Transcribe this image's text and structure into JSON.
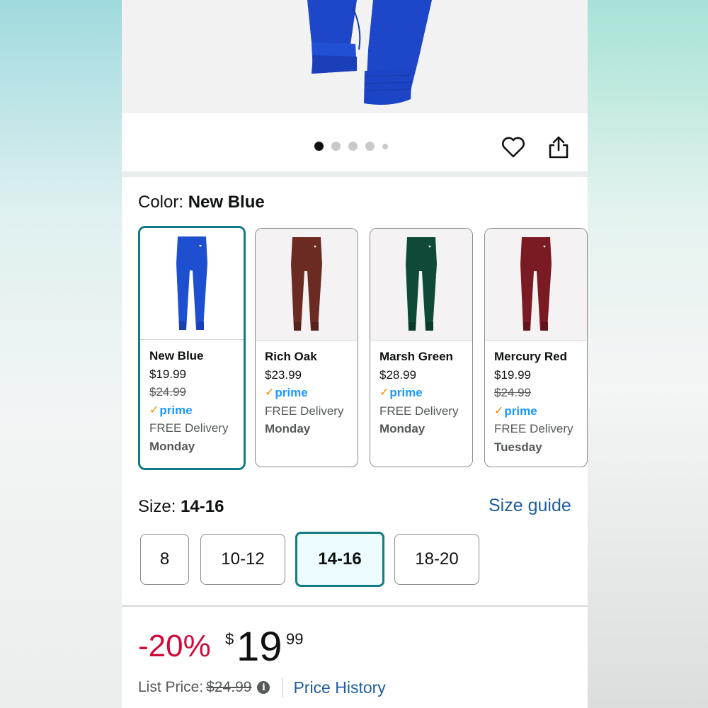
{
  "gallery": {
    "dots": 5,
    "active_dot": 1,
    "icons": [
      "heart-icon",
      "share-icon"
    ]
  },
  "color": {
    "label": "Color:",
    "selected": "New Blue",
    "options": [
      {
        "name": "New Blue",
        "price": "$19.99",
        "was": "$24.99",
        "prime": "prime",
        "delivery": "FREE Delivery",
        "day": "Monday",
        "hex": "#1e4fd1"
      },
      {
        "name": "Rich Oak",
        "price": "$23.99",
        "prime": "prime",
        "delivery": "FREE Delivery",
        "day": "Monday",
        "hex": "#6b2a22"
      },
      {
        "name": "Marsh Green",
        "price": "$28.99",
        "prime": "prime",
        "delivery": "FREE Delivery",
        "day": "Monday",
        "hex": "#0f4a38"
      },
      {
        "name": "Mercury Red",
        "price": "$19.99",
        "was": "$24.99",
        "prime": "prime",
        "delivery": "FREE Delivery",
        "day": "Tuesday",
        "hex": "#7a1a22"
      }
    ]
  },
  "size": {
    "label": "Size:",
    "selected": "14-16",
    "guide": "Size guide",
    "options": [
      "8",
      "10-12",
      "14-16",
      "18-20"
    ]
  },
  "pricing": {
    "discount": "-20%",
    "currency": "$",
    "whole": "19",
    "fraction": "99",
    "list_label": "List Price:",
    "list_price": "$24.99",
    "info_icon": "i",
    "history": "Price History"
  },
  "colors": {
    "accent": "#127b84",
    "link": "#1f5e9a",
    "discount": "#cc0c39",
    "prime": "#1a98ff",
    "prime_check": "#f08804"
  }
}
